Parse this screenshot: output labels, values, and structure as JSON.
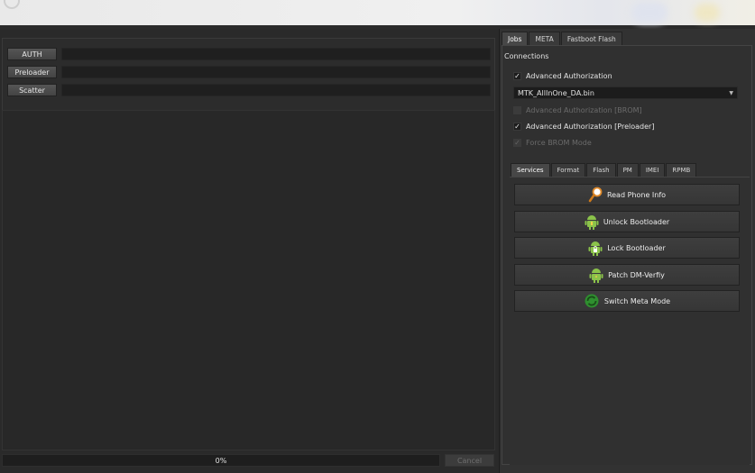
{
  "left": {
    "buttons": [
      "AUTH",
      "Preloader",
      "Scatter"
    ],
    "progress_text": "0%",
    "progress_value": 0,
    "cancel_label": "Cancel"
  },
  "right": {
    "tabs": [
      "Jobs",
      "META",
      "Fastboot Flash"
    ],
    "connections_label": "Connections",
    "adv_auth": {
      "label": "Advanced Authorization",
      "checked": true
    },
    "da_file": "MTK_AllInOne_DA.bin",
    "adv_auth_brom": {
      "label": "Advanced Authorization [BROM]",
      "checked": false
    },
    "adv_auth_preloader": {
      "label": "Advanced Authorization [Preloader]",
      "checked": true
    },
    "force_brom": {
      "label": "Force BROM Mode",
      "checked": true
    },
    "service_tabs": [
      "Services",
      "Format",
      "Flash",
      "PM",
      "IMEI",
      "RPMB"
    ],
    "services": [
      {
        "label": "Read Phone Info",
        "icon": "magnifier-icon"
      },
      {
        "label": "Unlock Bootloader",
        "icon": "android-unlock-icon"
      },
      {
        "label": "Lock Bootloader",
        "icon": "android-lock-icon"
      },
      {
        "label": "Patch DM-Verfiy",
        "icon": "android-patch-icon"
      },
      {
        "label": "Switch Meta Mode",
        "icon": "refresh-icon"
      }
    ]
  },
  "colors": {
    "accent_green": "#8bc34a",
    "switch_green": "#2f8f2f",
    "magnifier": "#e08a2a"
  }
}
